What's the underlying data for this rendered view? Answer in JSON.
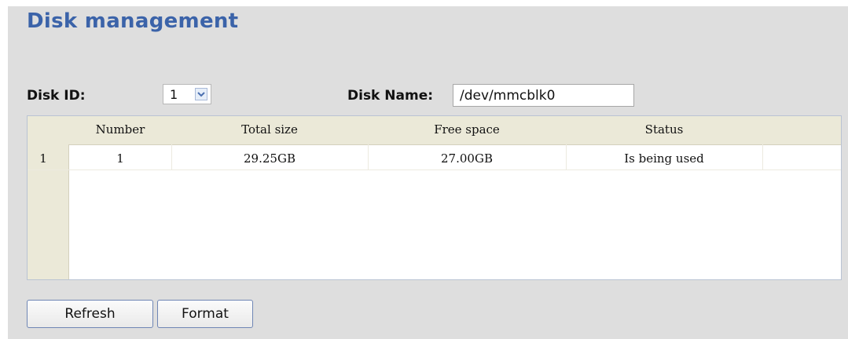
{
  "page": {
    "title": "Disk management"
  },
  "filters": {
    "disk_id_label": "Disk ID:",
    "disk_id_value": "1",
    "disk_name_label": "Disk Name:",
    "disk_name_value": "/dev/mmcblk0"
  },
  "table": {
    "columns": [
      "Number",
      "Total size",
      "Free space",
      "Status"
    ],
    "rows": [
      {
        "index": "1",
        "number": "1",
        "total_size": "29.25GB",
        "free_space": "27.00GB",
        "status": "Is being used"
      }
    ]
  },
  "buttons": {
    "refresh": "Refresh",
    "format": "Format"
  },
  "icons": {
    "select_arrow": "chevron-down-icon"
  },
  "colors": {
    "title": "#3b63a9",
    "panel_bg": "#dedede",
    "grid_header_bg": "#ebe9d8"
  }
}
